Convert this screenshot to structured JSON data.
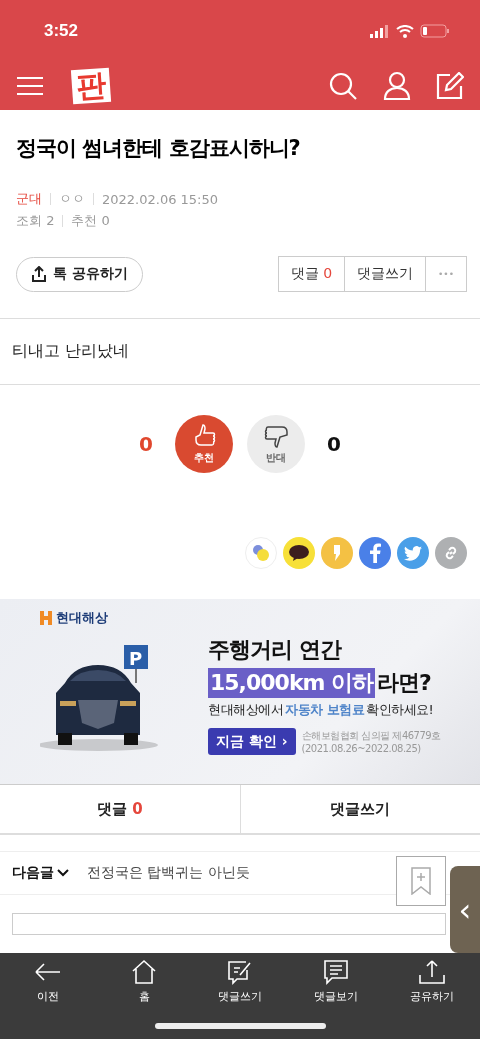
{
  "status_bar": {
    "time": "3:52"
  },
  "header": {
    "logo": "판"
  },
  "post": {
    "title": "정국이 썸녀한테 호감표시하니?",
    "category": "군대",
    "author": "ㅇㅇ",
    "date": "2022.02.06 15:50",
    "views_label": "조회",
    "views": "2",
    "likes_label": "추천",
    "likes": "0",
    "share_button": "톡 공유하기",
    "comment_button": "댓글",
    "comment_count": "0",
    "write_button": "댓글쓰기",
    "more_button": "•••",
    "body": "티내고 난리났네"
  },
  "votes": {
    "up_count": "0",
    "up_label": "추천",
    "down_label": "반대",
    "down_count": "0"
  },
  "share_icons": [
    {
      "kind": "blog"
    },
    {
      "kind": "kakaotalk"
    },
    {
      "kind": "kakaostory"
    },
    {
      "kind": "facebook"
    },
    {
      "kind": "twitter"
    },
    {
      "kind": "link"
    }
  ],
  "ad": {
    "brand": "현대해상",
    "headline": "주행거리 연간",
    "highlight": "15,000km 이하",
    "suffix": "라면?",
    "sub_pre": "현대해상에서 ",
    "sub_link": "자동차 보험료",
    "sub_post": " 확인하세요!",
    "cta": "지금 확인 ›",
    "fine_print_1": "손해보험협회 심의필 제46779호",
    "fine_print_2": "(2021.08.26~2022.08.25)",
    "parking_sign": "P"
  },
  "comment_tabs": [
    {
      "label": "댓글",
      "count": "0"
    },
    {
      "label": "댓글쓰기"
    }
  ],
  "next_post": {
    "label": "다음글",
    "title": "전정국은 탑백귀는 아닌듯"
  },
  "side_handle": "‹",
  "bottom_bar": [
    {
      "kind": "back",
      "label": "이전"
    },
    {
      "kind": "home",
      "label": "홈"
    },
    {
      "kind": "write",
      "label": "댓글쓰기"
    },
    {
      "kind": "view",
      "label": "댓글보기"
    },
    {
      "kind": "share",
      "label": "공유하기"
    }
  ]
}
